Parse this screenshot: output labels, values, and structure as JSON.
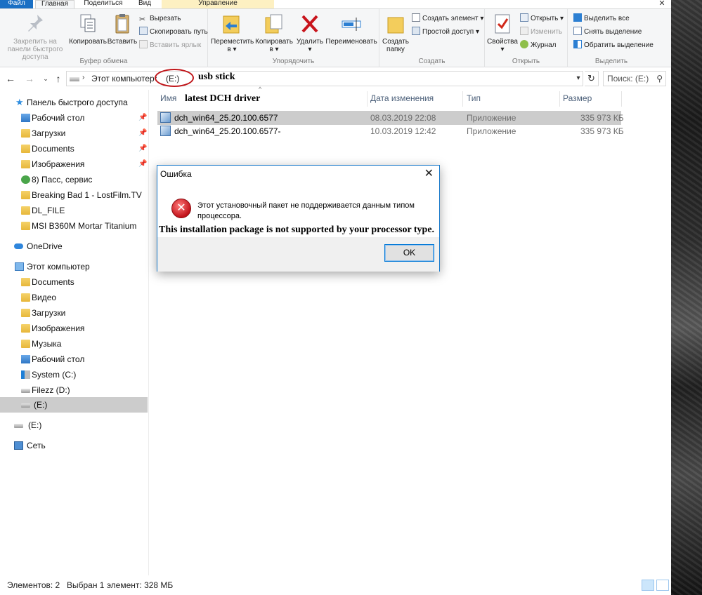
{
  "ribbon_tabs": {
    "file": "Файл",
    "home": "Главная",
    "share": "Поделиться",
    "view": "Вид",
    "manage": "Управление"
  },
  "ribbon": {
    "clipboard": {
      "label": "Буфер обмена",
      "pin": "Закрепить на панели быстрого доступа",
      "copy": "Копировать",
      "paste": "Вставить",
      "cut": "Вырезать",
      "copy_path": "Скопировать путь",
      "paste_shortcut": "Вставить ярлык"
    },
    "organize": {
      "label": "Упорядочить",
      "move_to": "Переместить в",
      "copy_to": "Копировать в",
      "delete": "Удалить",
      "rename": "Переименовать"
    },
    "create": {
      "label": "Создать",
      "new_folder": "Создать папку",
      "new_item": "Создать элемент",
      "easy_access": "Простой доступ"
    },
    "open": {
      "label": "Открыть",
      "properties": "Свойства",
      "open": "Открыть",
      "edit": "Изменить",
      "history": "Журнал"
    },
    "select": {
      "label": "Выделить",
      "select_all": "Выделить все",
      "select_none": "Снять выделение",
      "invert": "Обратить выделение"
    }
  },
  "address": {
    "computer": "Этот компьютер",
    "drive": "(E:)",
    "search_placeholder": "Поиск: (E:)",
    "annotation": "usb stick"
  },
  "nav": {
    "quick_access": "Панель быстрого доступа",
    "quick_items": [
      {
        "label": "Рабочий стол"
      },
      {
        "label": "Загрузки"
      },
      {
        "label": "Documents"
      },
      {
        "label": "Изображения"
      },
      {
        "label": "8) Пасс, сервис"
      },
      {
        "label": "Breaking Bad 1 - LostFilm.TV"
      },
      {
        "label": "DL_FILE"
      },
      {
        "label": "MSI B360M Mortar Titanium"
      }
    ],
    "onedrive": "OneDrive",
    "this_pc": "Этот компьютер",
    "pc_items": [
      {
        "label": "Documents"
      },
      {
        "label": "Видео"
      },
      {
        "label": "Загрузки"
      },
      {
        "label": "Изображения"
      },
      {
        "label": "Музыка"
      },
      {
        "label": "Рабочий стол"
      },
      {
        "label": "System (C:)"
      },
      {
        "label": "Filezz (D:)"
      },
      {
        "label": "(E:)"
      }
    ],
    "drive_e": "(E:)",
    "network": "Сеть"
  },
  "columns": {
    "name": "Имя",
    "date": "Дата изменения",
    "type": "Тип",
    "size": "Размер",
    "annotation": "latest DCH driver"
  },
  "files": [
    {
      "name": "dch_win64_25.20.100.6577",
      "date": "08.03.2019 22:08",
      "type": "Приложение",
      "size": "335 973 КБ"
    },
    {
      "name": "dch_win64_25.20.100.6577-",
      "date": "10.03.2019 12:42",
      "type": "Приложение",
      "size": "335 973 КБ"
    }
  ],
  "status": {
    "items": "Элементов: 2",
    "selected": "Выбран 1 элемент: 328 МБ"
  },
  "dialog": {
    "title": "Ошибка",
    "message": "Этот установочный пакет не поддерживается данным типом процессора.",
    "annotation": "This installation package is not supported by your  processor type.",
    "ok": "OK"
  }
}
